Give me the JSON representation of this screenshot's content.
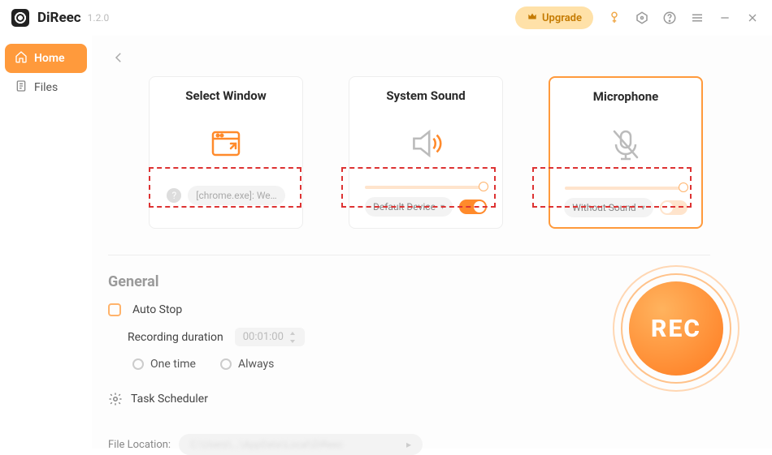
{
  "app": {
    "name": "DiReec",
    "version": "1.2.0",
    "upgrade": "Upgrade"
  },
  "sidebar": {
    "items": [
      {
        "label": "Home"
      },
      {
        "label": "Files"
      }
    ]
  },
  "cards": {
    "window": {
      "title": "Select Window",
      "value": "[chrome.exe]: We…"
    },
    "sound": {
      "title": "System Sound",
      "select": "Default Device"
    },
    "mic": {
      "title": "Microphone",
      "select": "Without Sound"
    }
  },
  "general": {
    "title": "General",
    "auto_stop": "Auto Stop",
    "duration_label": "Recording duration",
    "duration_value": "00:01:00",
    "one_time": "One time",
    "always": "Always",
    "task_scheduler": "Task Scheduler",
    "file_location_label": "File Location:",
    "file_location_value": "C:\\Users\\...\\AppData\\Local\\DiReec"
  },
  "rec": {
    "label": "REC"
  }
}
